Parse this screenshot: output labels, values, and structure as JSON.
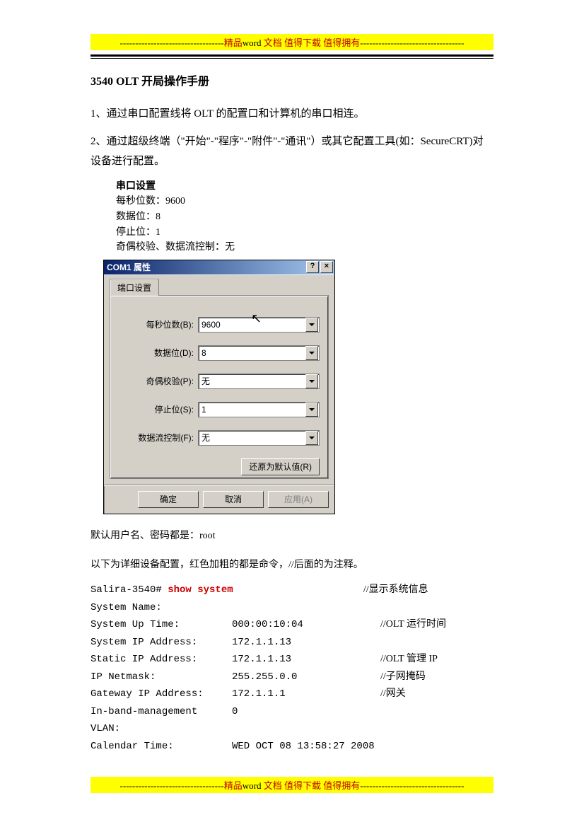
{
  "banner": {
    "dashes_left": "----------------------------------",
    "text_prefix": "精品",
    "text_word": "word",
    "text_suffix": " 文档 值得下载 值得拥有",
    "dashes_right": "----------------------------------"
  },
  "title": "3540 OLT 开局操作手册",
  "body": {
    "p1": "1、通过串口配置线将 OLT 的配置口和计算机的串口相连。",
    "p2": "2、通过超级终端（\"开始\"-\"程序\"-\"附件\"-\"通讯\"）或其它配置工具(如：SecureCRT)对设备进行配置。"
  },
  "serial_settings": {
    "heading": "串口设置",
    "baud": "每秒位数：9600",
    "data": "数据位：8",
    "stop": "停止位：1",
    "parity": "奇偶校验、数据流控制：无"
  },
  "dialog": {
    "title": "COM1 属性",
    "help_btn": "?",
    "close_btn": "×",
    "tab": "端口设置",
    "fields": {
      "baud": {
        "label": "每秒位数(B):",
        "value": "9600"
      },
      "data": {
        "label": "数据位(D):",
        "value": "8"
      },
      "parity": {
        "label": "奇偶校验(P):",
        "value": "无"
      },
      "stop": {
        "label": "停止位(S):",
        "value": "1"
      },
      "flow": {
        "label": "数据流控制(F):",
        "value": "无"
      }
    },
    "restore": "还原为默认值(R)",
    "ok": "确定",
    "cancel": "取消",
    "apply": "应用(A)"
  },
  "after": {
    "default_cred": "默认用户名、密码都是：root",
    "intro": "以下为详细设备配置，红色加粗的都是命令，//后面的为注释。"
  },
  "cli": {
    "prompt": "Salira-3540# ",
    "cmd": "show system",
    "cmd_comment": "//显示系统信息",
    "lines": [
      {
        "c1": "System Name:",
        "c2": "",
        "c3": ""
      },
      {
        "c1": "System Up Time:",
        "c2": "000:00:10:04",
        "c3": "//OLT 运行时间"
      },
      {
        "c1": "System IP Address:",
        "c2": "172.1.1.13",
        "c3": ""
      },
      {
        "c1": "Static IP Address:",
        "c2": "172.1.1.13",
        "c3": "//OLT 管理 IP"
      },
      {
        "c1": "IP Netmask:",
        "c2": "255.255.0.0",
        "c3": "//子网掩码"
      },
      {
        "c1": "Gateway IP Address:",
        "c2": "172.1.1.1",
        "c3": "//网关"
      },
      {
        "c1": "In-band-management VLAN:",
        "c2": "0",
        "c3": ""
      },
      {
        "c1": "Calendar Time:",
        "c2": "WED OCT 08 13:58:27 2008",
        "c3": ""
      }
    ]
  }
}
